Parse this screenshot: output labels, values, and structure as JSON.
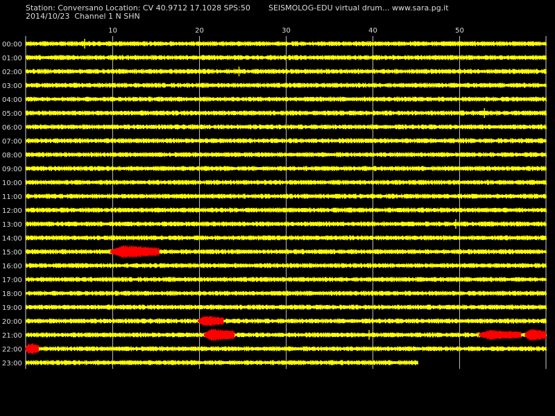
{
  "header": {
    "station_line": "Station: Conversano Location: CV 40.9712 17.1028 SPS:50",
    "date_line": "2014/10/23  Channel 1 N SHN",
    "app_line": "SEISMOLOG-EDU virtual drum... www.sara.pg.it"
  },
  "chart_data": {
    "type": "line",
    "x_ticks": [
      "10",
      "20",
      "30",
      "40",
      "50"
    ],
    "x_tick_values": [
      10,
      20,
      30,
      40,
      50
    ],
    "xlim": [
      0,
      60
    ],
    "y_labels": [
      "00:00",
      "01:00",
      "02:00",
      "03:00",
      "04:00",
      "05:00",
      "06:00",
      "07:00",
      "08:00",
      "09:00",
      "10:00",
      "11:00",
      "12:00",
      "13:00",
      "14:00",
      "15:00",
      "16:00",
      "17:00",
      "18:00",
      "19:00",
      "20:00",
      "21:00",
      "22:00",
      "23:00"
    ],
    "grid": true,
    "trace_color": "#ffff00",
    "event_color": "#ff0000",
    "background": "#000000",
    "last_trace_end_minute": 45.2,
    "events": [
      {
        "hour": 15,
        "start": 9.8,
        "end": 15.4,
        "peak": 1.0
      },
      {
        "hour": 20,
        "start": 19.9,
        "end": 22.8,
        "peak": 0.8
      },
      {
        "hour": 21,
        "start": 20.6,
        "end": 24.1,
        "peak": 1.0
      },
      {
        "hour": 21,
        "start": 52.3,
        "end": 57.1,
        "peak": 0.7
      },
      {
        "hour": 21,
        "start": 57.6,
        "end": 60.0,
        "peak": 1.0
      },
      {
        "hour": 22,
        "start": 0.0,
        "end": 1.5,
        "peak": 0.9
      }
    ],
    "spikes": [
      {
        "hour": 0,
        "minute": 6.8
      },
      {
        "hour": 2,
        "minute": 24.6
      },
      {
        "hour": 5,
        "minute": 52.9
      },
      {
        "hour": 13,
        "minute": 49.6
      },
      {
        "hour": 21,
        "minute": 39.6
      }
    ]
  }
}
